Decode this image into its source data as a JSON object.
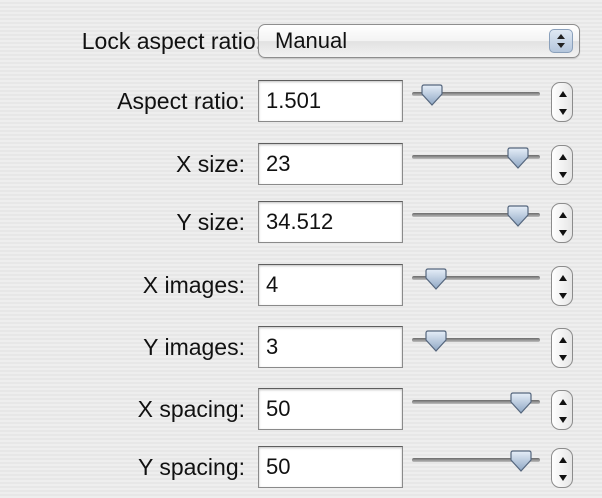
{
  "lock": {
    "label": "Lock aspect ratio:",
    "value": "Manual"
  },
  "rows": [
    {
      "label": "Aspect ratio:",
      "value": "1.501",
      "slider_fraction": 0.08
    },
    {
      "label": "X size:",
      "value": "23",
      "slider_fraction": 0.9
    },
    {
      "label": "Y size:",
      "value": "34.512",
      "slider_fraction": 0.9
    },
    {
      "label": "X images:",
      "value": "4",
      "slider_fraction": 0.12
    },
    {
      "label": "Y images:",
      "value": "3",
      "slider_fraction": 0.12
    },
    {
      "label": "X spacing:",
      "value": "50",
      "slider_fraction": 0.93
    },
    {
      "label": "Y spacing:",
      "value": "50",
      "slider_fraction": 0.93
    }
  ]
}
